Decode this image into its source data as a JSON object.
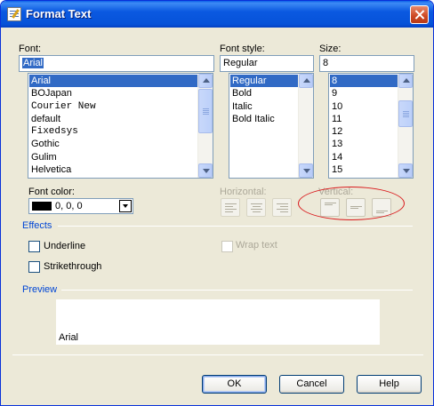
{
  "window": {
    "title": "Format Text"
  },
  "font": {
    "label": "Font:",
    "value": "Arial",
    "list": [
      "Arial",
      "BOJapan",
      "Courier New",
      "default",
      "Fixedsys",
      "Gothic",
      "Gulim",
      "Helvetica"
    ],
    "selected_index": 0
  },
  "font_style": {
    "label": "Font style:",
    "value": "Regular",
    "list": [
      "Regular",
      "Bold",
      "Italic",
      "Bold Italic"
    ],
    "selected_index": 0
  },
  "size": {
    "label": "Size:",
    "value": "8",
    "list": [
      "8",
      "9",
      "10",
      "11",
      "12",
      "13",
      "14",
      "15"
    ],
    "selected_index": 0
  },
  "font_color": {
    "label": "Font color:",
    "value": "0, 0, 0",
    "swatch": "#000000"
  },
  "horizontal": {
    "label": "Horizontal:"
  },
  "vertical": {
    "label": "Vertical:"
  },
  "effects": {
    "title": "Effects",
    "underline": "Underline",
    "strikethrough": "Strikethrough",
    "wrap_text": "Wrap text"
  },
  "preview": {
    "title": "Preview",
    "sample": "Arial"
  },
  "buttons": {
    "ok": "OK",
    "cancel": "Cancel",
    "help": "Help"
  },
  "colors": {
    "accent": "#316ac5",
    "section": "#0046d5",
    "highlight_ellipse": "#d9191c"
  }
}
